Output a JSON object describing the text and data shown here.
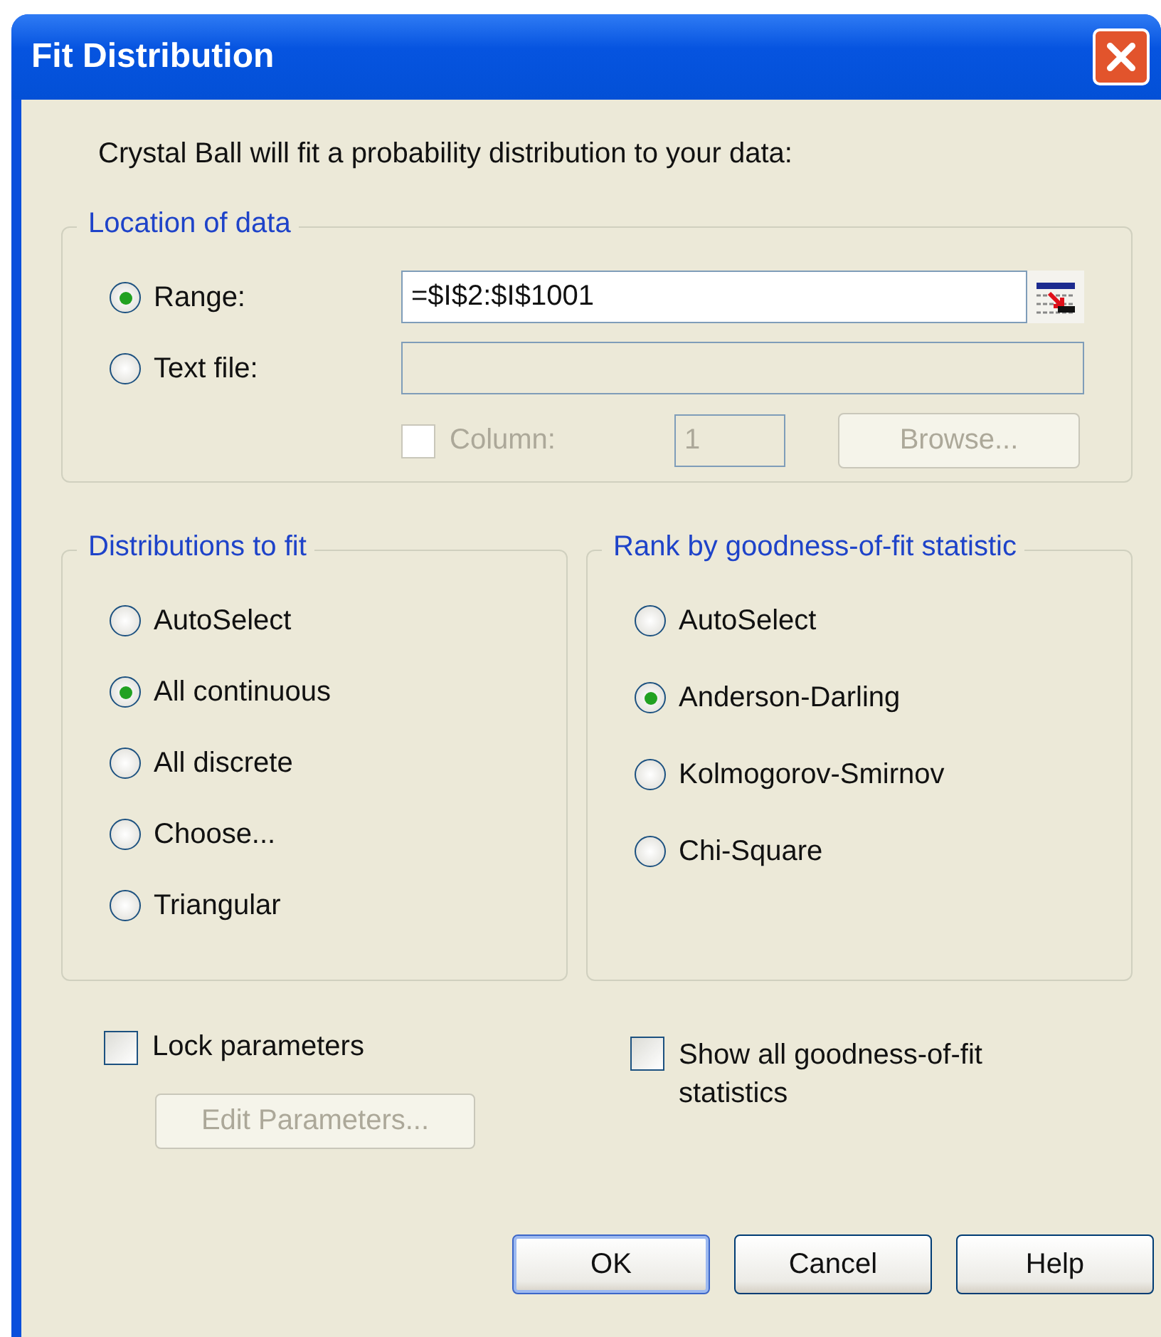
{
  "window": {
    "title": "Fit Distribution"
  },
  "intro": "Crystal Ball will fit a probability distribution to your data:",
  "location_of_data": {
    "title": "Location of data",
    "sources": [
      {
        "label": "Range:",
        "selected": true
      },
      {
        "label": "Text file:",
        "selected": false
      }
    ],
    "range_value": "=$I$2:$I$1001",
    "text_file_field": {
      "disabled": true
    },
    "column": {
      "label": "Column:",
      "checked": false,
      "disabled": true
    },
    "column_value": {
      "value": "1",
      "disabled": true
    },
    "browse_button": {
      "label": "Browse...",
      "disabled": true
    }
  },
  "distributions_to_fit": {
    "title": "Distributions to fit",
    "options": [
      {
        "label": "AutoSelect",
        "selected": false
      },
      {
        "label": "All continuous",
        "selected": true
      },
      {
        "label": "All discrete",
        "selected": false
      },
      {
        "label": "Choose...",
        "selected": false
      },
      {
        "label": "Triangular",
        "selected": false
      }
    ]
  },
  "rank_by": {
    "title": "Rank by goodness-of-fit statistic",
    "options": [
      {
        "label": "AutoSelect",
        "selected": false
      },
      {
        "label": "Anderson-Darling",
        "selected": true
      },
      {
        "label": "Kolmogorov-Smirnov",
        "selected": false
      },
      {
        "label": "Chi-Square",
        "selected": false
      }
    ]
  },
  "lock_parameters": {
    "label": "Lock parameters",
    "checked": false
  },
  "edit_parameters_button": {
    "label": "Edit Parameters...",
    "disabled": true
  },
  "show_all_statistics": {
    "label": "Show all goodness-of-fit statistics",
    "checked": false
  },
  "buttons": [
    {
      "label": "OK",
      "default": true
    },
    {
      "label": "Cancel",
      "default": false
    },
    {
      "label": "Help",
      "default": false
    }
  ]
}
